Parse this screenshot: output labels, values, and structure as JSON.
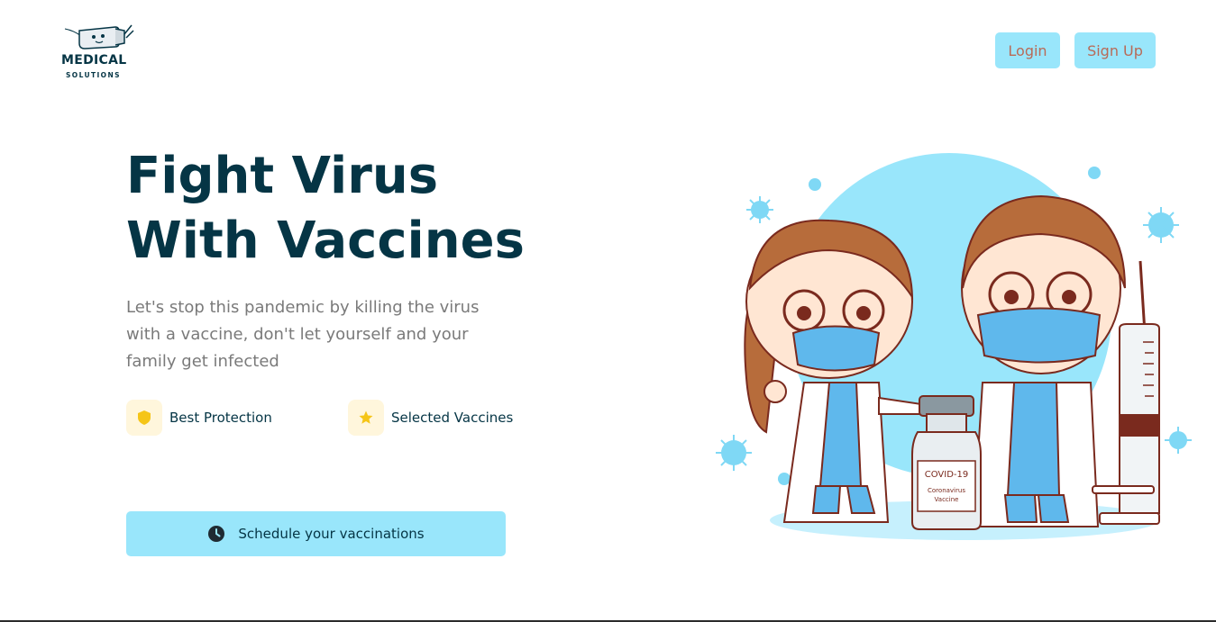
{
  "brand": {
    "name": "MEDICAL",
    "tagline": "SOLUTIONS",
    "icon": "syringe-mascot-icon"
  },
  "nav": {
    "login_label": "Login",
    "signup_label": "Sign Up"
  },
  "hero": {
    "title_lines": [
      "Fight Virus",
      "With Vaccines"
    ],
    "description_lines": [
      "Let's stop this pandemic by killing the virus",
      "with a vaccine, don't let yourself and your",
      "family get infected"
    ],
    "features": [
      {
        "label": "Best Protection",
        "icon": "shield-icon"
      },
      {
        "label": "Selected Vaccines",
        "icon": "star-icon"
      }
    ],
    "cta_label": "Schedule your vaccinations",
    "cta_icon": "clock-icon"
  },
  "illustration": {
    "bottle_label_line1": "COVID-19",
    "bottle_label_line2": "Coronavirus",
    "bottle_label_line3": "Vaccine"
  },
  "colors": {
    "primary_dark": "#053545",
    "button_bg": "#99e6fb",
    "nav_text": "#b86a57",
    "feature_bg": "#fff6dc",
    "accent_yellow": "#f5c518"
  }
}
